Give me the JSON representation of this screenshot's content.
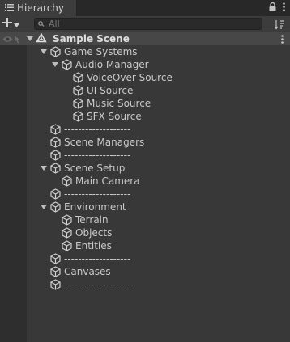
{
  "tab": {
    "title": "Hierarchy",
    "lock_icon": "lock-icon",
    "menu_icon": "kebab-icon",
    "list_icon": "list-icon"
  },
  "toolbar": {
    "create_icon": "plus-icon",
    "search_placeholder": "All",
    "search_value": "",
    "sort_icon": "sort-icon"
  },
  "scene": {
    "name": "Sample Scene"
  },
  "items": [
    {
      "label": "Game Systems",
      "depth": 0,
      "expanded": true
    },
    {
      "label": "Audio Manager",
      "depth": 1,
      "expanded": true
    },
    {
      "label": "VoiceOver Source",
      "depth": 2
    },
    {
      "label": "UI Source",
      "depth": 2
    },
    {
      "label": "Music Source",
      "depth": 2
    },
    {
      "label": "SFX Source",
      "depth": 2
    },
    {
      "label": "-------------------",
      "depth": 0
    },
    {
      "label": "Scene Managers",
      "depth": 0
    },
    {
      "label": "-------------------",
      "depth": 0
    },
    {
      "label": "Scene Setup",
      "depth": 0,
      "expanded": true
    },
    {
      "label": "Main Camera",
      "depth": 1
    },
    {
      "label": "-------------------",
      "depth": 0
    },
    {
      "label": "Environment",
      "depth": 0,
      "expanded": true
    },
    {
      "label": "Terrain",
      "depth": 1
    },
    {
      "label": "Objects",
      "depth": 1
    },
    {
      "label": "Entities",
      "depth": 1
    },
    {
      "label": "-------------------",
      "depth": 0
    },
    {
      "label": "Canvases",
      "depth": 0
    },
    {
      "label": "-------------------",
      "depth": 0
    }
  ]
}
